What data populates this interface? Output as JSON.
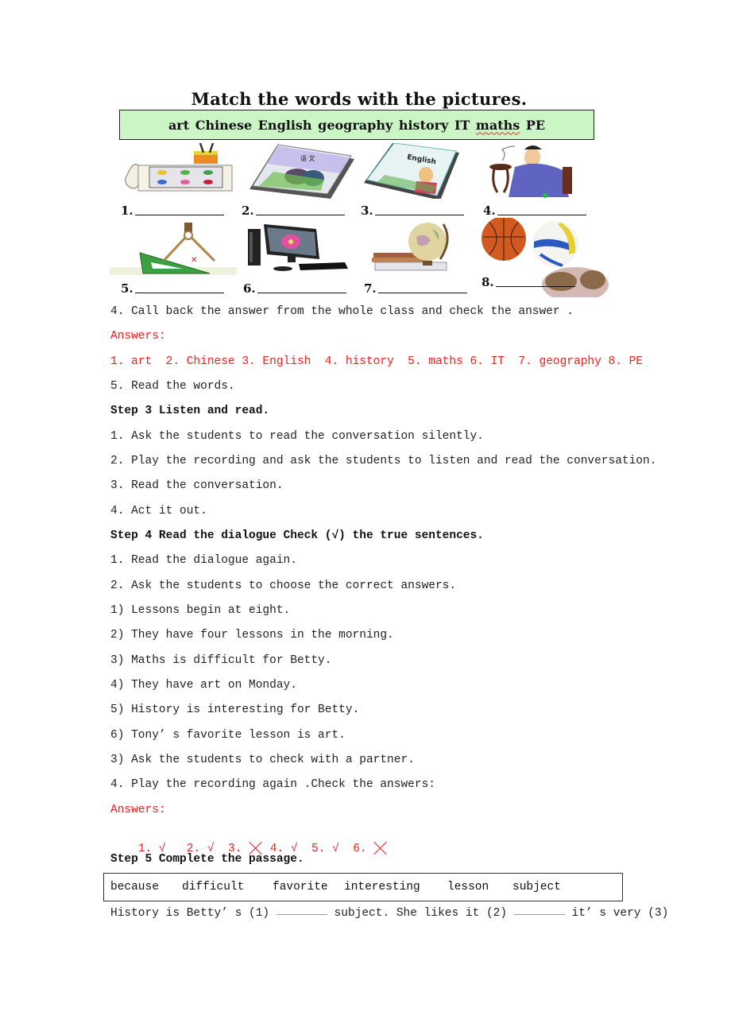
{
  "exercise": {
    "title": "Match the words with the pictures.",
    "word_bank": [
      "art",
      "Chinese",
      "English",
      "geography",
      "history",
      "IT",
      "maths",
      "PE"
    ],
    "pictures": [
      {
        "number": "1.",
        "icon": "art-palette-icon"
      },
      {
        "number": "2.",
        "icon": "chinese-book-icon"
      },
      {
        "number": "3.",
        "icon": "english-book-icon"
      },
      {
        "number": "4.",
        "icon": "history-figure-icon"
      },
      {
        "number": "5.",
        "icon": "maths-set-square-icon"
      },
      {
        "number": "6.",
        "icon": "computer-icon"
      },
      {
        "number": "7.",
        "icon": "globe-icon"
      },
      {
        "number": "8.",
        "icon": "balls-icon"
      }
    ],
    "book_labels": {
      "chinese": "语 文",
      "english": "English"
    }
  },
  "lines": {
    "call_back": "4. Call back the answer from the whole class and check the answer .",
    "answers_label_1": "Answers:",
    "answers_1": "1. art  2. Chinese 3. English  4. history  5. maths 6. IT  7. geography 8. PE",
    "read_words": "5. Read the words.",
    "step3_heading": "Step 3 Listen and read.",
    "step3_items": [
      "1. Ask the students to read the conversation silently.",
      "2. Play the recording and ask the students to listen and read the conversation.",
      "3. Read the conversation.",
      "4. Act it out."
    ],
    "step4_heading": "Step 4 Read the dialogue Check (√) the true sentences.",
    "step4_items": [
      "1. Read the dialogue again.",
      "2. Ask the students to choose the correct answers.",
      "1) Lessons begin at eight.",
      "2) They have four lessons in the morning.",
      "3) Maths is difficult for Betty.",
      "4) They have art on Monday.",
      "5) History is interesting for Betty.",
      "6) Tony’ s favorite lesson is art.",
      "3) Ask the students to check with a partner.",
      "4. Play the recording again .Check the answers:"
    ],
    "answers_label_2": "Answers:",
    "answers_2": [
      {
        "num": "1.",
        "mark": "√",
        "correct": true
      },
      {
        "num": "2.",
        "mark": "√",
        "correct": true
      },
      {
        "num": "3.",
        "mark": "×",
        "correct": false
      },
      {
        "num": "4.",
        "mark": "√",
        "correct": true
      },
      {
        "num": "5.",
        "mark": "√",
        "correct": true
      },
      {
        "num": "6.",
        "mark": "×",
        "correct": false
      }
    ],
    "step5_heading": "Step 5 Complete the passage.",
    "step5_words": [
      "because",
      "difficult",
      "favorite",
      "interesting",
      "lesson",
      "subject"
    ],
    "passage": {
      "part1": "History is Betty’ s (1) ",
      "part2": " subject. She likes it (2) ",
      "part3": " it’ s very (3)"
    }
  },
  "colors": {
    "answer_red": "#ef2020",
    "word_box_green": "#ccf5c6",
    "text": "#222222"
  }
}
